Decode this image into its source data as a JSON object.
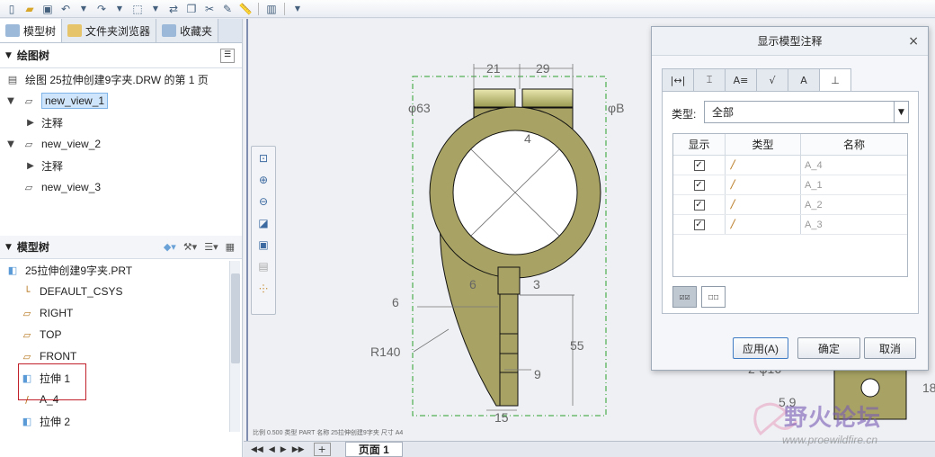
{
  "toolbar": {
    "icons": [
      "new-file",
      "open-folder",
      "save",
      "undo",
      "undo-menu",
      "redo",
      "redo-menu",
      "select-box",
      "select-menu",
      "regenerate",
      "window",
      "close-window",
      "repaint",
      "measure",
      "layers",
      "more"
    ]
  },
  "left_panel": {
    "tabs": [
      {
        "label": "模型树",
        "icon": "model-tree-icon"
      },
      {
        "label": "文件夹浏览器",
        "icon": "folder-browser-icon"
      },
      {
        "label": "收藏夹",
        "icon": "favorites-icon"
      }
    ],
    "drawing_tree": {
      "heading": "绘图树",
      "page_item": "绘图 25拉伸创建9字夹.DRW 的第 1 页",
      "items": [
        {
          "label": "new_view_1",
          "selected": true
        },
        {
          "label": "注释",
          "child": true
        },
        {
          "label": "new_view_2"
        },
        {
          "label": "注释",
          "child": true
        },
        {
          "label": "new_view_3"
        }
      ]
    },
    "model_tree": {
      "heading": "模型树",
      "items": [
        {
          "label": "25拉伸创建9字夹.PRT",
          "icon": "part-icon"
        },
        {
          "label": "DEFAULT_CSYS",
          "icon": "csys-icon"
        },
        {
          "label": "RIGHT",
          "icon": "datum-plane-icon"
        },
        {
          "label": "TOP",
          "icon": "datum-plane-icon"
        },
        {
          "label": "FRONT",
          "icon": "datum-plane-icon"
        },
        {
          "label": "拉伸 1",
          "icon": "extrude-icon"
        },
        {
          "label": "A_4",
          "icon": "axis-icon"
        },
        {
          "label": "拉伸 2",
          "icon": "extrude-icon"
        }
      ]
    }
  },
  "drawing": {
    "dims": {
      "d21": "21",
      "d29": "29",
      "phi63": "φ63",
      "phiB": "φB",
      "d4": "4",
      "d6a": "6",
      "d3": "3",
      "d6b": "6",
      "r140": "R140",
      "d55": "55",
      "d9": "9",
      "d15": "15",
      "d2phi16": "2-φ16",
      "d5_9": "5.9",
      "d18": "18"
    },
    "footer_text": "比例 0.500   类型 PART   名称 25拉伸创建9字夹   尺寸 A4"
  },
  "bottom_bar": {
    "page_tab": "页面 1",
    "add": "+"
  },
  "dialog": {
    "title": "显示模型注释",
    "close": "×",
    "tabs": [
      "|↔|",
      "⌶",
      "A≡",
      "√",
      "A",
      "⊥"
    ],
    "type_label": "类型:",
    "type_value": "全部",
    "columns": [
      "显示",
      "类型",
      "名称"
    ],
    "rows": [
      {
        "checked": "✓",
        "type": "/",
        "name": "A_4"
      },
      {
        "checked": "✓",
        "type": "/",
        "name": "A_1"
      },
      {
        "checked": "✓",
        "type": "/",
        "name": "A_2"
      },
      {
        "checked": "✓",
        "type": "/",
        "name": "A_3"
      }
    ],
    "buttons": {
      "apply": "应用(A)",
      "ok": "确定",
      "cancel": "取消"
    }
  },
  "watermark": {
    "title": "野火论坛",
    "url": "www.proewildfire.cn"
  },
  "colors": {
    "accent": "#3f7cc4",
    "part_fill": "#a8a364",
    "selection_box": "#c0212b",
    "view_border": "#2aa02a"
  }
}
